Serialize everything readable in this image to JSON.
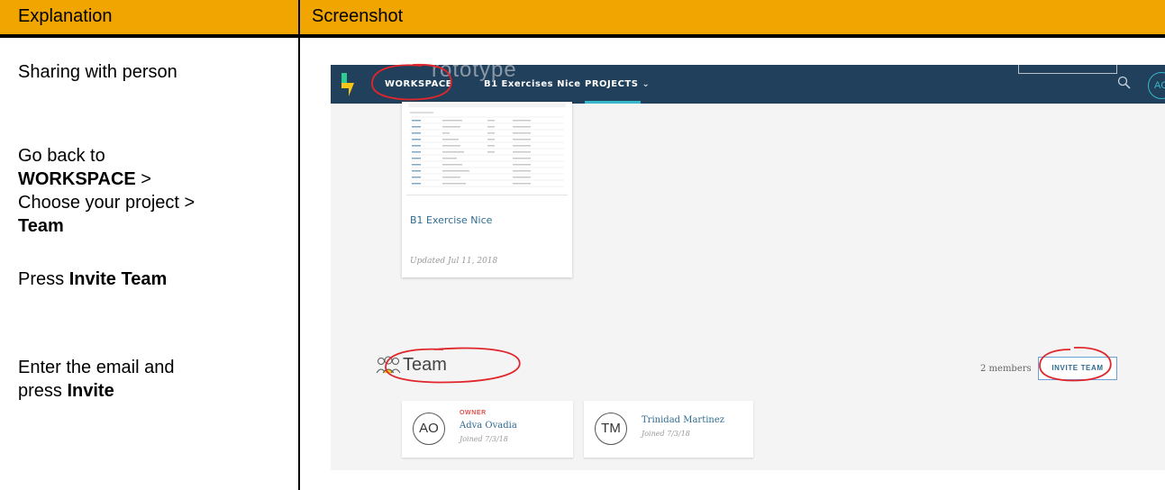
{
  "header": {
    "col1": "Explanation",
    "col2": "Screenshot"
  },
  "steps": {
    "s1": "Sharing with person",
    "s2_a": "Go back to",
    "s2_b": "WORKSPACE",
    "s2_c": " >",
    "s2_d": "Choose your project >",
    "s2_e": "Team",
    "s3_a": "Press ",
    "s3_b": "Invite Team",
    "s4_a": "Enter the email and",
    "s4_b": "press ",
    "s4_c": "Invite"
  },
  "app": {
    "nav": {
      "workspace": "WORKSPACE",
      "project": "B1 Exercises Nice",
      "projects": "PROJECTS",
      "user_initials": "AO"
    },
    "ghost_title": "rototype",
    "project_card": {
      "title": "B1 Exercise Nice",
      "updated": "Updated Jul 11, 2018"
    },
    "team": {
      "title": "Team",
      "members_count": "2 members",
      "invite_label": "INVITE TEAM",
      "members": [
        {
          "initials": "AO",
          "role": "OWNER",
          "name": "Adva Ovadia",
          "joined": "Joined 7/3/18"
        },
        {
          "initials": "TM",
          "role": "",
          "name": "Trinidad Martinez",
          "joined": "Joined 7/3/18"
        }
      ]
    }
  },
  "colors": {
    "header": "#f0a500",
    "nav": "#21405c",
    "accent": "#36b8c9",
    "annotation": "#e0262b"
  }
}
